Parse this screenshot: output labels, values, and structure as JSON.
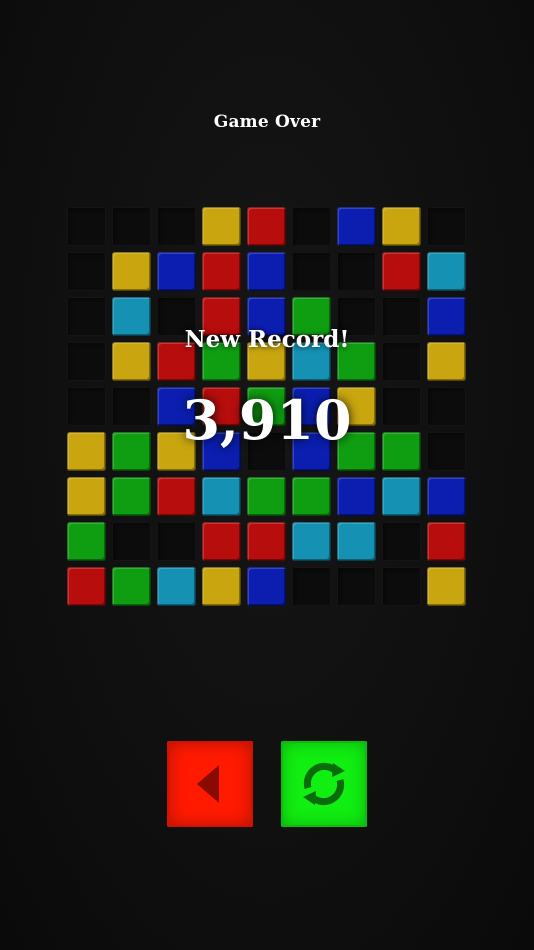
{
  "header": {
    "title": "Game Over"
  },
  "result": {
    "record_label": "New Record!",
    "score": "3,910"
  },
  "board": {
    "rows": 9,
    "cols": 9,
    "cells": [
      [
        "empty",
        "empty",
        "empty",
        "yellow",
        "red",
        "empty",
        "blue",
        "yellow",
        "empty"
      ],
      [
        "empty",
        "yellow",
        "blue",
        "red",
        "blue",
        "empty",
        "empty",
        "red",
        "cyan"
      ],
      [
        "empty",
        "cyan",
        "empty",
        "red",
        "blue",
        "green",
        "empty",
        "empty",
        "blue"
      ],
      [
        "empty",
        "yellow",
        "red",
        "green",
        "yellow",
        "cyan",
        "green",
        "empty",
        "yellow"
      ],
      [
        "empty",
        "empty",
        "blue",
        "red",
        "green",
        "blue",
        "yellow",
        "empty",
        "empty"
      ],
      [
        "yellow",
        "green",
        "yellow",
        "blue",
        "empty",
        "blue",
        "green",
        "green",
        "empty"
      ],
      [
        "yellow",
        "green",
        "red",
        "cyan",
        "green",
        "green",
        "blue",
        "cyan",
        "blue"
      ],
      [
        "green",
        "empty",
        "empty",
        "red",
        "red",
        "cyan",
        "cyan",
        "empty",
        "red"
      ],
      [
        "red",
        "green",
        "cyan",
        "yellow",
        "blue",
        "empty",
        "empty",
        "empty",
        "yellow"
      ]
    ]
  },
  "colors": {
    "red": "#b80d0d",
    "blue": "#0b1eb0",
    "yellow": "#c9a60f",
    "green": "#0f9e12",
    "cyan": "#1591b3",
    "back_button": "#ff1a00",
    "restart_button": "#11ee11"
  },
  "controls": {
    "back_icon": "triangle-left-icon",
    "restart_icon": "refresh-icon"
  }
}
